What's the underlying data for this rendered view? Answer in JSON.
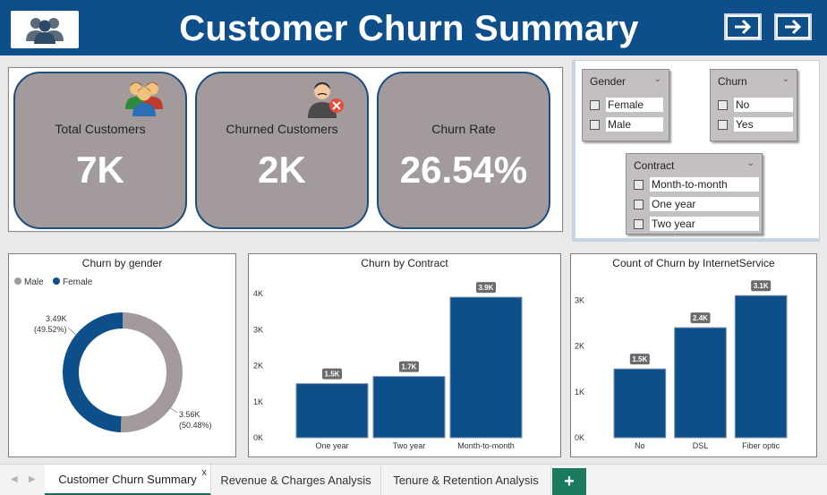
{
  "header": {
    "title": "Customer Churn Summary",
    "accent": "#0d4f8b"
  },
  "kpis": [
    {
      "label": "Total Customers",
      "value": "7K",
      "icon": "customers-group-icon"
    },
    {
      "label": "Churned Customers",
      "value": "2K",
      "icon": "churned-customer-icon"
    },
    {
      "label": "Churn Rate",
      "value": "26.54%"
    }
  ],
  "slicers": {
    "gender": {
      "title": "Gender",
      "options": [
        "Female",
        "Male"
      ]
    },
    "churn": {
      "title": "Churn",
      "options": [
        "No",
        "Yes"
      ]
    },
    "contract": {
      "title": "Contract",
      "options": [
        "Month-to-month",
        "One year",
        "Two year"
      ]
    }
  },
  "chart_data": [
    {
      "type": "pie",
      "title": "Churn by gender",
      "legend": [
        "Male",
        "Female"
      ],
      "legend_position": "top-left",
      "colors": {
        "Male": "#a39b9b",
        "Female": "#0d4f8b"
      },
      "slices": [
        {
          "name": "Male",
          "value": 3.56,
          "label": "3.56K",
          "pct": "(50.48%)"
        },
        {
          "name": "Female",
          "value": 3.49,
          "label": "3.49K",
          "pct": "(49.52%)"
        }
      ]
    },
    {
      "type": "bar",
      "title": "Churn by Contract",
      "categories": [
        "One year",
        "Two year",
        "Month-to-month"
      ],
      "values": [
        1.5,
        1.7,
        3.9
      ],
      "data_labels": [
        "1.5K",
        "1.7K",
        "3.9K"
      ],
      "yticks": [
        "0K",
        "1K",
        "2K",
        "3K",
        "4K"
      ],
      "ylim": [
        0,
        4.2
      ],
      "color": "#0d4f8b"
    },
    {
      "type": "bar",
      "title": "Count of Churn by InternetService",
      "categories": [
        "No",
        "DSL",
        "Fiber optic"
      ],
      "values": [
        1.5,
        2.4,
        3.1
      ],
      "data_labels": [
        "1.5K",
        "2.4K",
        "3.1K"
      ],
      "yticks": [
        "0K",
        "1K",
        "2K",
        "3K"
      ],
      "ylim": [
        0,
        3.3
      ],
      "color": "#0d4f8b"
    }
  ],
  "tabs": [
    {
      "label": "Customer Churn Summary",
      "close": "x"
    },
    {
      "label": "Revenue & Charges Analysis"
    },
    {
      "label": "Tenure & Retention Analysis"
    }
  ],
  "add_tab_label": "+"
}
